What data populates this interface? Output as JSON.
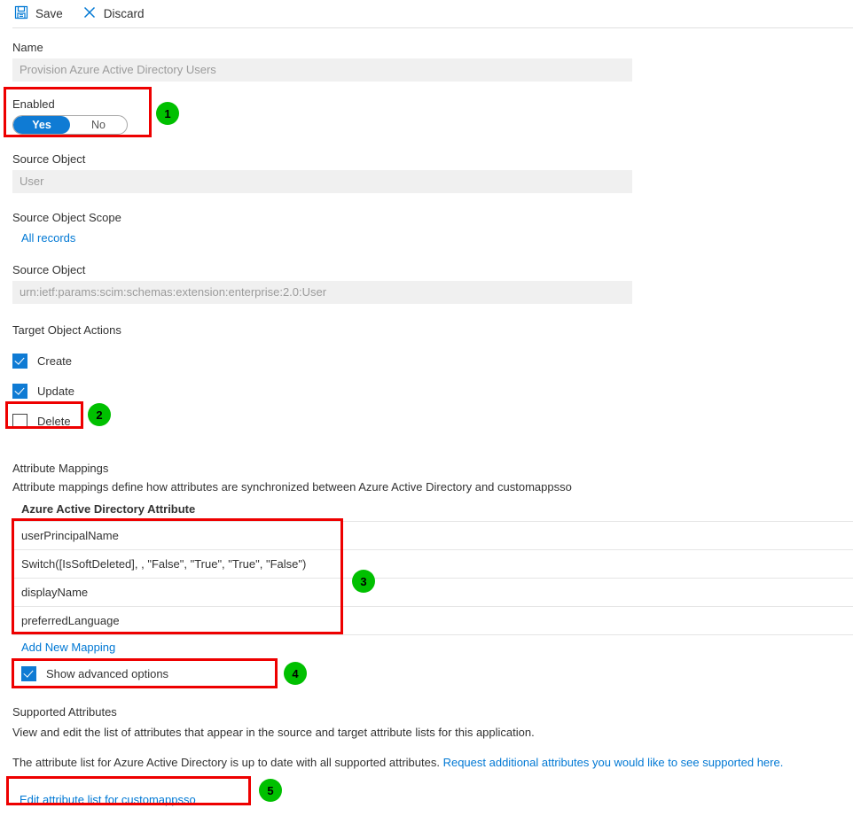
{
  "toolbar": {
    "save_label": "Save",
    "discard_label": "Discard"
  },
  "form": {
    "name_label": "Name",
    "name_value": "Provision Azure Active Directory Users",
    "enabled_label": "Enabled",
    "toggle_yes": "Yes",
    "toggle_no": "No",
    "source_object_label": "Source Object",
    "source_object_value": "User",
    "source_object_scope_label": "Source Object Scope",
    "source_object_scope_value": "All records",
    "source_object2_label": "Source Object",
    "source_object2_value": "urn:ietf:params:scim:schemas:extension:enterprise:2.0:User",
    "target_actions_label": "Target Object Actions",
    "actions": [
      {
        "label": "Create",
        "checked": true
      },
      {
        "label": "Update",
        "checked": true
      },
      {
        "label": "Delete",
        "checked": false
      }
    ]
  },
  "attribute_mappings": {
    "title": "Attribute Mappings",
    "description": "Attribute mappings define how attributes are synchronized between Azure Active Directory and customappsso",
    "column_header": "Azure Active Directory Attribute",
    "rows": [
      "userPrincipalName",
      "Switch([IsSoftDeleted], , \"False\", \"True\", \"True\", \"False\")",
      "displayName",
      "preferredLanguage"
    ],
    "add_new_mapping": "Add New Mapping",
    "show_advanced_label": "Show advanced options",
    "show_advanced_checked": true
  },
  "supported_attributes": {
    "title": "Supported Attributes",
    "description": "View and edit the list of attributes that appear in the source and target attribute lists for this application.",
    "status_text": "The attribute list for Azure Active Directory is up to date with all supported attributes.",
    "request_link": "Request additional attributes you would like to see supported here.",
    "edit_link": "Edit attribute list for customappsso"
  },
  "annotations": {
    "badges": [
      "1",
      "2",
      "3",
      "4",
      "5"
    ]
  },
  "colors": {
    "accent": "#0078d4",
    "toggle_on": "#0f7bd4",
    "highlight": "#ee0000",
    "badge": "#00c000",
    "disabled_bg": "#f0f0f0"
  }
}
